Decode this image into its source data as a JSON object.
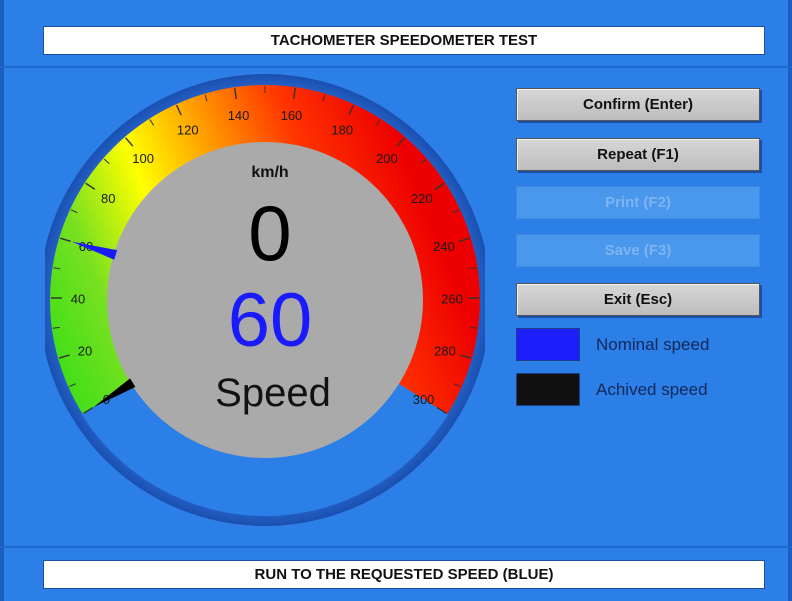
{
  "header": {
    "title": "TACHOMETER SPEEDOMETER TEST"
  },
  "gauge": {
    "unit": "km/h",
    "scale_labels": [
      "0",
      "20",
      "40",
      "60",
      "80",
      "100",
      "120",
      "140",
      "160",
      "180",
      "200",
      "220",
      "240",
      "260",
      "280",
      "300"
    ],
    "min": 0,
    "max": 300,
    "achieved_value": 0,
    "achieved_display": "0",
    "nominal_value": 60,
    "nominal_display": "60",
    "caption": "Speed",
    "colors": {
      "achieved": "#000000",
      "nominal": "#1a1aff",
      "green": "#22dd22",
      "yellow": "#ffff00",
      "orange": "#ff8c00",
      "red": "#ee1100",
      "face": "#aaaaaa"
    }
  },
  "buttons": {
    "confirm": "Confirm (Enter)",
    "repeat": "Repeat (F1)",
    "print": "Print (F2)",
    "save": "Save (F3)",
    "exit": "Exit (Esc)"
  },
  "legend": {
    "nominal_label": "Nominal speed",
    "nominal_color": "#1e1efa",
    "achieved_label": "Achived speed",
    "achieved_color": "#111111"
  },
  "status": {
    "message": "RUN TO THE REQUESTED SPEED (BLUE)"
  }
}
